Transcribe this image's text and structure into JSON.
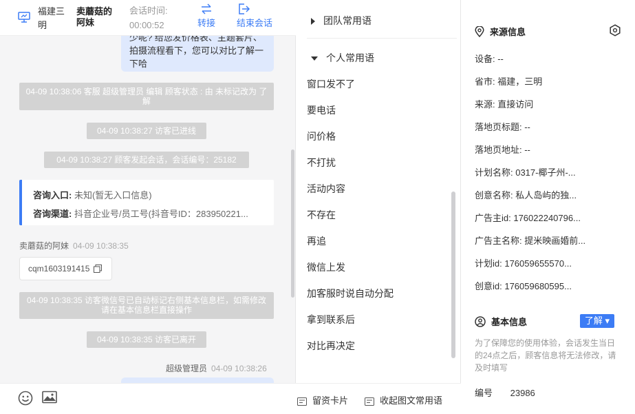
{
  "header": {
    "location": "福建三明",
    "visitor_name": "卖蘑菇的阿妹",
    "session_time_label": "会话时间:",
    "session_time": "00:00:52",
    "transfer_label": "转接",
    "end_label": "结束会话"
  },
  "chat": {
    "partial_bubble": "少呢? 给您发价格表、主题套片、拍摄流程看下，您可以对比了解一下哈",
    "sys1": "04-09 10:38:06 客服 超级管理员 编辑 顾客状态 : 由 未标记改为 了解",
    "sys2": "04-09 10:38:27 访客已进线",
    "sys3": "04-09 10:38:27 顾客发起会话，会话编号：25182",
    "entry_label": "咨询入口:",
    "entry_value": "未知(暂无入口信息)",
    "channel_label": "咨询渠道:",
    "channel_value": "抖音企业号/员工号(抖音号ID：283950221...",
    "visitor_sender": "卖蘑菇的阿妹",
    "visitor_time": "04-09 10:38:35",
    "visitor_msg": "cqm1603191415",
    "sys4": "04-09 10:38:35 访客微信号已自动标记右侧基本信息栏，如需修改请在基本信息栏直接操作",
    "sys5": "04-09 10:38:35 访客已离开",
    "agent_sender": "超级管理员",
    "agent_time": "04-09 10:38:26"
  },
  "phrases": {
    "team_label": "团队常用语",
    "personal_label": "个人常用语",
    "items": [
      "窗口发不了",
      "要电话",
      "问价格",
      "不打扰",
      "活动内容",
      "不存在",
      "再追",
      "微信上发",
      "加客服时说自动分配",
      "拿到联系后",
      "对比再决定"
    ],
    "footer_card": "留资卡片",
    "footer_collect": "收起图文常用语"
  },
  "source_info": {
    "title": "来源信息",
    "device": "设备: --",
    "province_city": "省市: 福建，三明",
    "source": "来源: 直接访问",
    "landing_title": "落地页标题: --",
    "landing_url": "落地页地址: --",
    "plan_name": "计划名称: 0317-椰子州-...",
    "creative_name": "创意名称: 私人岛屿的独...",
    "advertiser_id": "广告主id: 176022240796...",
    "advertiser_name": "广告主名称: 提米映画婚前...",
    "plan_id": "计划id: 176059655570...",
    "creative_id": "创意id: 176059680595..."
  },
  "basic_info": {
    "title": "基本信息",
    "status_badge": "了解 ▾",
    "note": "为了保障您的使用体验，会话发生当日的24点之后，顾客信息将无法修改，请及时填写",
    "number_label": "编号",
    "number_value": "23986"
  },
  "colors": {
    "accent": "#3c7cf5",
    "system_msg_bg": "#d3d3d3",
    "bubble_bg": "#dfe9fd"
  }
}
